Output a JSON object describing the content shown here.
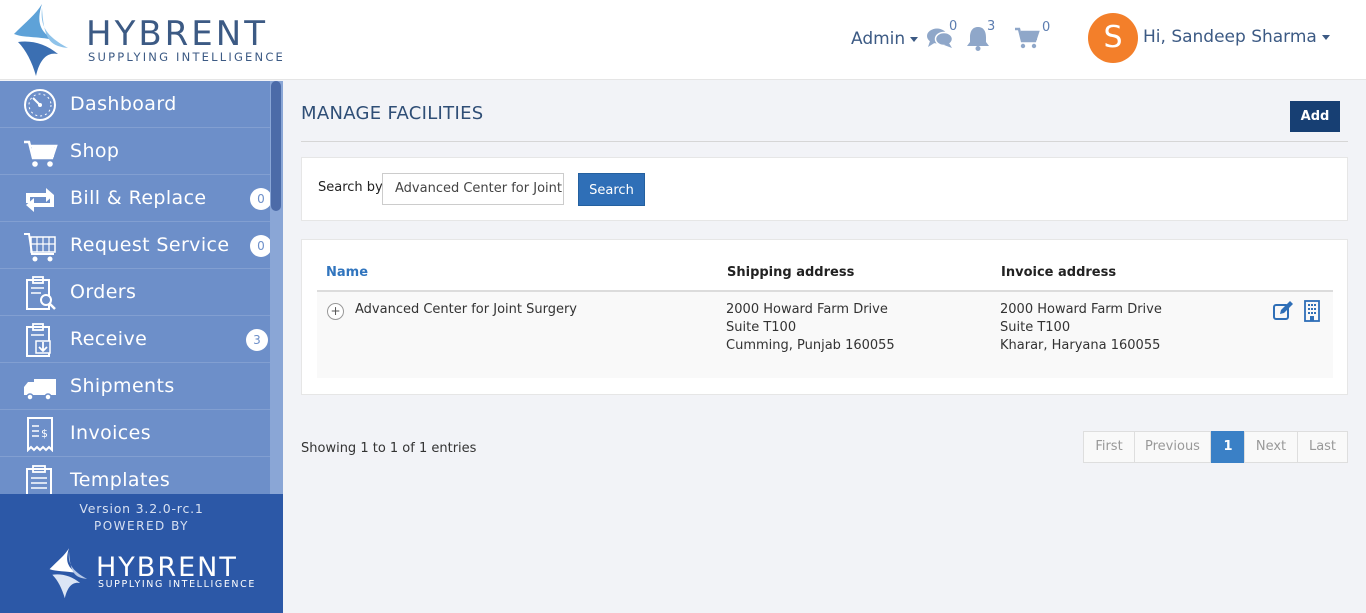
{
  "brand": {
    "name": "HYBRENT",
    "tagline": "SUPPLYING INTELLIGENCE"
  },
  "header": {
    "admin_label": "Admin",
    "messages_count": "0",
    "notifications_count": "3",
    "cart_count": "0",
    "avatar_letter": "S",
    "greeting": "Hi, Sandeep Sharma"
  },
  "sidebar": {
    "items": [
      {
        "label": "Dashboard",
        "icon": "dashboard-gauge-icon",
        "badge": null
      },
      {
        "label": "Shop",
        "icon": "cart-icon",
        "badge": null
      },
      {
        "label": "Bill & Replace",
        "icon": "exchange-icon",
        "badge": "0"
      },
      {
        "label": "Request Service",
        "icon": "service-cart-icon",
        "badge": "0"
      },
      {
        "label": "Orders",
        "icon": "clipboard-search-icon",
        "badge": null
      },
      {
        "label": "Receive",
        "icon": "clipboard-download-icon",
        "badge": "3"
      },
      {
        "label": "Shipments",
        "icon": "truck-icon",
        "badge": null
      },
      {
        "label": "Invoices",
        "icon": "invoice-icon",
        "badge": null
      },
      {
        "label": "Templates",
        "icon": "template-icon",
        "badge": null
      }
    ],
    "footer": {
      "version": "Version 3.2.0-rc.1",
      "powered_by": "POWERED BY",
      "brand": "HYBRENT",
      "tagline": "SUPPLYING INTELLIGENCE"
    }
  },
  "main": {
    "title": "MANAGE FACILITIES",
    "add_label": "Add",
    "search": {
      "label": "Search by",
      "value": "Advanced Center for Joint Surgery",
      "button": "Search"
    },
    "table": {
      "columns": [
        "Name",
        "Shipping address",
        "Invoice address"
      ],
      "rows": [
        {
          "expand": "+",
          "name": "Advanced Center for Joint Surgery",
          "shipping": [
            "2000 Howard Farm Drive",
            "Suite T100",
            "Cumming, Punjab 160055"
          ],
          "invoice": [
            "2000 Howard Farm Drive",
            "Suite T100",
            "Kharar, Haryana 160055"
          ]
        }
      ]
    },
    "showing": "Showing 1 to 1 of 1 entries",
    "pagination": [
      "First",
      "Previous",
      "1",
      "Next",
      "Last"
    ]
  },
  "colors": {
    "sidebar": "#6d8fc9",
    "sidebar_footer": "#2c58a7",
    "primary": "#2f6fb7",
    "add_button": "#173f73",
    "avatar": "#f37f2a"
  }
}
